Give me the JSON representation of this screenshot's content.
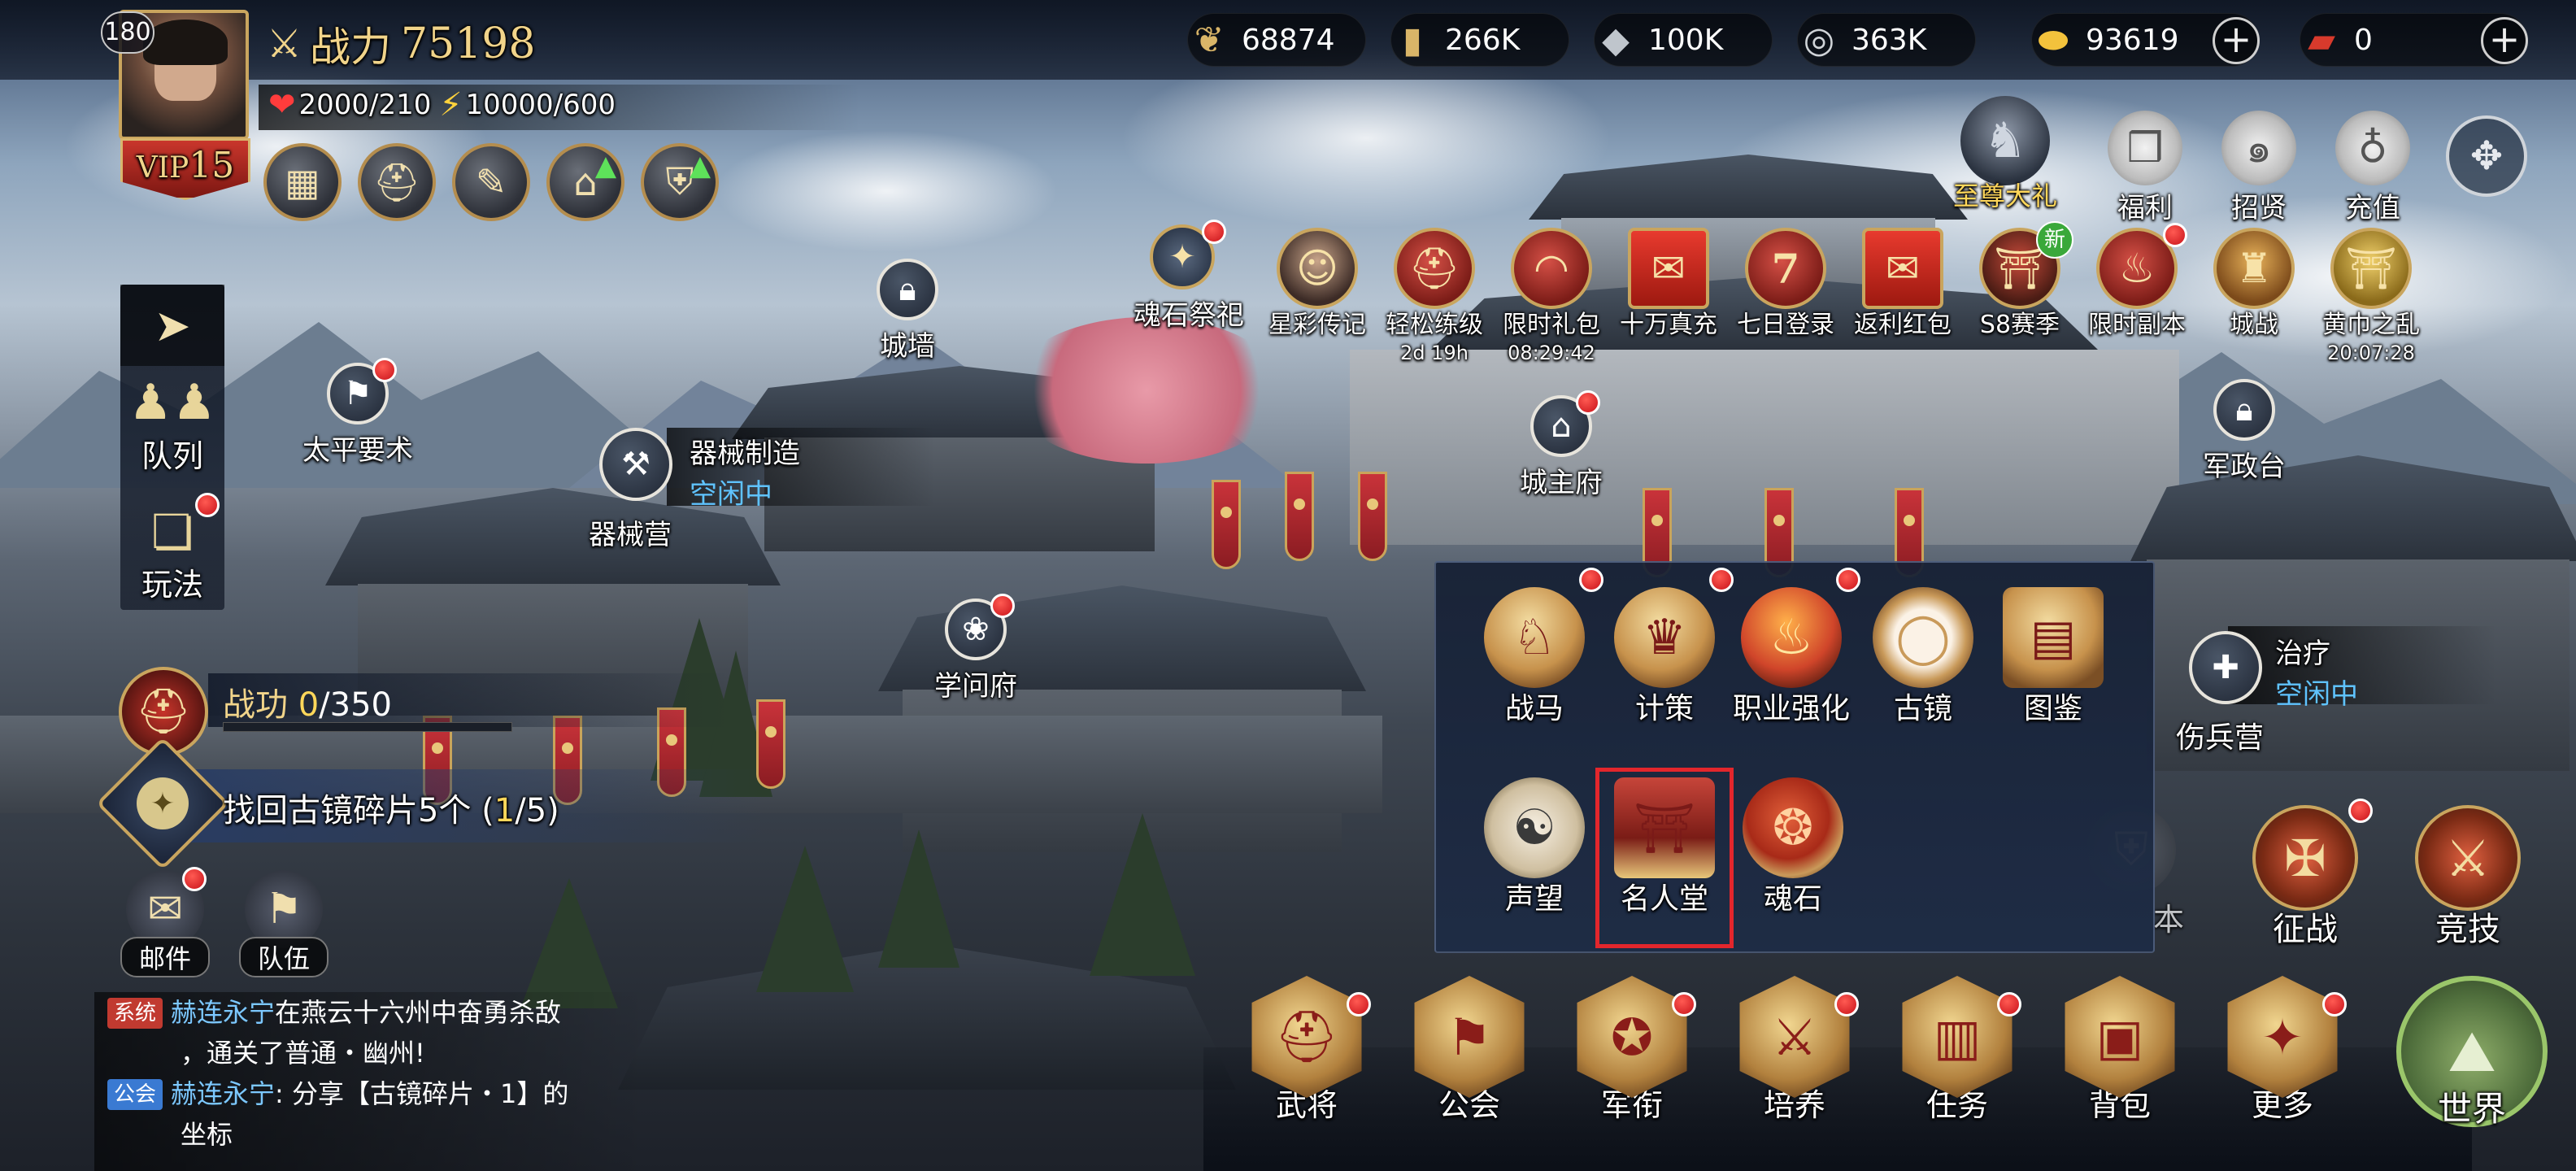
{
  "player": {
    "level": "180",
    "vip_prefix": "VIP",
    "vip_level": "15",
    "power_label": "战力",
    "power_value": "75198",
    "stamina": "2000/210",
    "energy": "10000/600"
  },
  "resources": [
    {
      "icon": "wheat-icon",
      "value": "68874"
    },
    {
      "icon": "wood-icon",
      "value": "266K"
    },
    {
      "icon": "iron-icon",
      "value": "100K"
    },
    {
      "icon": "coin-icon",
      "value": "363K"
    },
    {
      "icon": "gold-ingot-icon",
      "value": "93619"
    },
    {
      "icon": "red-ticket-icon",
      "value": "0"
    }
  ],
  "top_right": {
    "supreme_gift": "至尊大礼",
    "welfare": "福利",
    "recruit": "招贤",
    "recharge": "充值"
  },
  "activities": [
    {
      "label": "魂石祭祀",
      "sub": ""
    },
    {
      "label": "星彩传记",
      "sub": ""
    },
    {
      "label": "轻松练级",
      "sub": "2d 19h"
    },
    {
      "label": "限时礼包",
      "sub": "08:29:42"
    },
    {
      "label": "十万真充",
      "sub": ""
    },
    {
      "label": "七日登录",
      "sub": ""
    },
    {
      "label": "返利红包",
      "sub": ""
    },
    {
      "label": "S8赛季",
      "sub": ""
    },
    {
      "label": "限时副本",
      "sub": ""
    },
    {
      "label": "城战",
      "sub": ""
    },
    {
      "label": "黄巾之乱",
      "sub": "20:07:28"
    }
  ],
  "seven_day_num": "7",
  "new_badge": "新",
  "left_panel": {
    "queue": "队列",
    "gameplay": "玩法",
    "merit_label": "战功",
    "merit_value": "0",
    "merit_total": "/350",
    "quest_text": "找回古镜碎片5个",
    "quest_open": " (",
    "quest_progress": "1",
    "quest_total": "/5)",
    "mail": "邮件",
    "team": "队伍"
  },
  "map_labels": {
    "wall": "城墙",
    "taiping": "太平要术",
    "workshop_title": "器械制造",
    "workshop_status": "空闲中",
    "workshop": "器械营",
    "academy": "学问府",
    "lord": "城主府",
    "military": "军政台",
    "heal_title": "治疗",
    "heal_status": "空闲中",
    "hospital": "伤兵营"
  },
  "popup_items": [
    {
      "label": "战马",
      "icon": "warhorse-icon"
    },
    {
      "label": "计策",
      "icon": "strategy-icon"
    },
    {
      "label": "职业强化",
      "icon": "class-enhance-icon"
    },
    {
      "label": "古镜",
      "icon": "ancient-mirror-icon"
    },
    {
      "label": "图鉴",
      "icon": "codex-icon"
    },
    {
      "label": "声望",
      "icon": "prestige-icon"
    },
    {
      "label": "名人堂",
      "icon": "hall-of-fame-icon"
    },
    {
      "label": "魂石",
      "icon": "soul-stone-icon"
    }
  ],
  "right_menu": {
    "conquest": "征战",
    "arena": "竞技",
    "partial": "本"
  },
  "bottom_menu": [
    "武将",
    "公会",
    "军衔",
    "培养",
    "任务",
    "背包",
    "更多"
  ],
  "world": "世界",
  "chat": {
    "line1_tag": "系统",
    "line1_name": "赫连永宁",
    "line1_text": "在燕云十六州中奋勇杀敌",
    "line2_text": "，通关了普通・幽州!",
    "line3_tag": "公会",
    "line3_name": "赫连永宁",
    "line3_text": ": 分享【古镜碎片・1】的",
    "line4_text": "坐标"
  },
  "colors": {
    "highlight_box": "#e3262c",
    "gold_text": "#f1d48a",
    "status_blue": "#5fc3ff",
    "notify_red": "#e5202a"
  }
}
